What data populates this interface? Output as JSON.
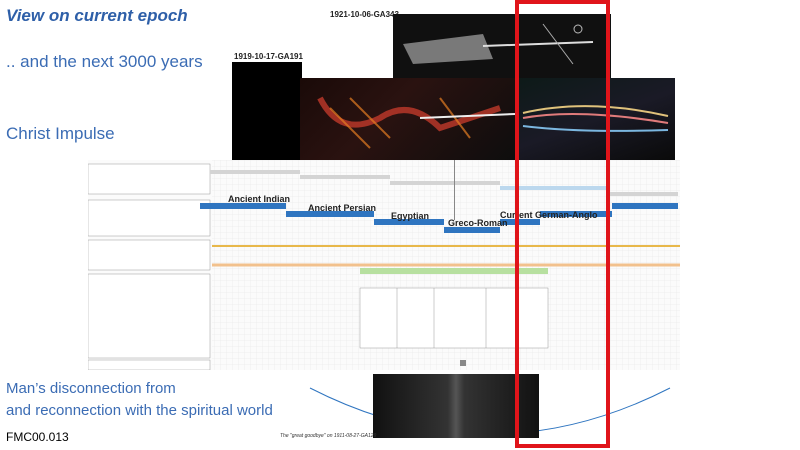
{
  "slide": {
    "title": "View on current epoch",
    "subtitle": ".. and the next 3000 years",
    "section": "Christ Impulse",
    "bottom_line1": "Man’s disconnection from",
    "bottom_line2": "and reconnection with the spiritual world",
    "code": "FMC00.013"
  },
  "images": {
    "top_label": "1921-10-06-GA343",
    "main_label": "1919-10-17-GA191"
  },
  "timeline": {
    "epochs": [
      {
        "name": "Ancient Indian"
      },
      {
        "name": "Ancient Persian"
      },
      {
        "name": "Egyptian"
      },
      {
        "name": "Greco-Roman"
      },
      {
        "name": "Current German-Anglo"
      }
    ]
  },
  "bottom": {
    "caption": "The \"great goodbye\" on 1911-08-27-GA129"
  },
  "colors": {
    "accent": "#3b6cb4",
    "highlight": "#e0141a",
    "bar": "#2f75c0"
  }
}
